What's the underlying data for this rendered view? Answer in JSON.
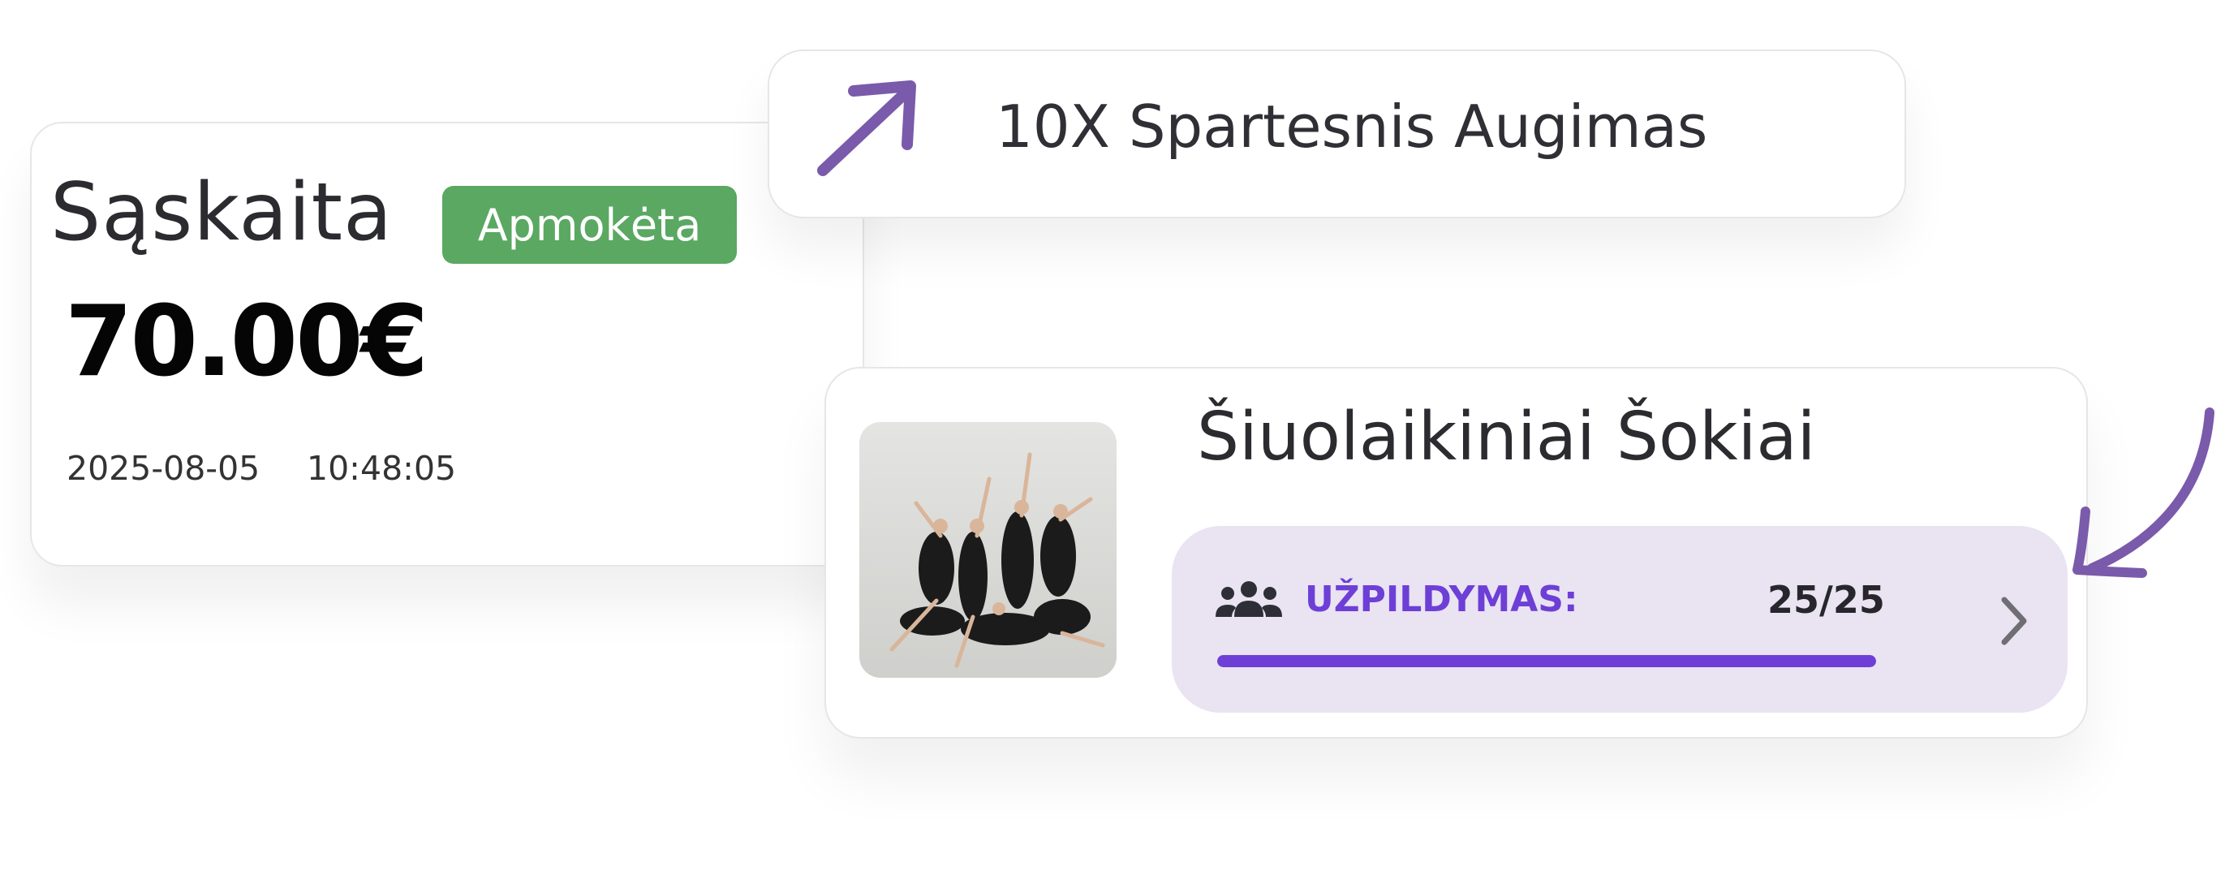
{
  "invoice": {
    "title": "Sąskaita",
    "status_badge": "Apmokėta",
    "amount": "70.00€",
    "date": "2025-08-05",
    "time": "10:48:05"
  },
  "growth": {
    "text": "10X Spartesnis Augimas",
    "icon": "arrow-up-right-icon"
  },
  "dance_class": {
    "title": "Šiuolaikiniai Šokiai",
    "capacity_label": "UŽPILDYMAS:",
    "capacity_count": "25/25",
    "capacity_fraction": 1.0,
    "people_icon": "group-icon",
    "chevron_icon": "chevron-right-icon"
  },
  "colors": {
    "badge_green": "#5aa862",
    "accent_purple": "#6d3fd6",
    "arrow_purple": "#7a5aaa",
    "capacity_bg": "#e9e3f2"
  }
}
